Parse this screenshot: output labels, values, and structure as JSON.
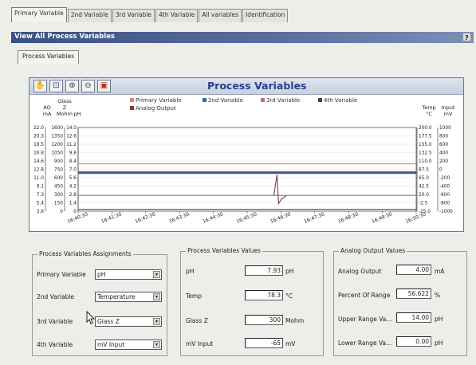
{
  "tabs": [
    "Primary Variable",
    "2nd Variable",
    "3rd Variable",
    "4th Variable",
    "All variables",
    "Identification"
  ],
  "window": {
    "title": "View All Process Variables",
    "help": "?"
  },
  "subtab": "Process Variables",
  "chart_data": {
    "type": "line",
    "title": "Process Variables",
    "legend": [
      "Primary Variable",
      "2nd Variable",
      "3rd Variable",
      "4th Variable",
      "Analog Output"
    ],
    "legend_colors": [
      "#e0857a",
      "#3b63ba",
      "#b07a82",
      "#444444",
      "#7a3a4a"
    ],
    "left_axes": [
      {
        "header": [
          "AO",
          "mA"
        ],
        "ticks": [
          "22.0",
          "20.3",
          "18.5",
          "16.8",
          "14.6",
          "12.8",
          "11.0",
          "9.1",
          "7.3",
          "5.4",
          "3.6"
        ]
      },
      {
        "header": [
          "Glass",
          "Z",
          "Mohm"
        ],
        "ticks": [
          "1600",
          "1350",
          "1200",
          "1050",
          "900",
          "750",
          "600",
          "450",
          "300",
          "150",
          "0"
        ]
      },
      {
        "header": [
          "pH"
        ],
        "ticks": [
          "14.0",
          "12.6",
          "11.2",
          "9.8",
          "8.4",
          "7.0",
          "5.6",
          "4.2",
          "2.8",
          "1.4",
          "0"
        ]
      }
    ],
    "right_axes": [
      {
        "header": [
          "Temp",
          "°C"
        ],
        "ticks": [
          "200.0",
          "177.5",
          "155.0",
          "132.5",
          "110.0",
          "87.5",
          "65.0",
          "42.5",
          "20.0",
          "-2.5",
          "-25.0"
        ]
      },
      {
        "header": [
          "Input",
          "mV"
        ],
        "ticks": [
          "1000",
          "800",
          "600",
          "400",
          "200",
          "0",
          "-200",
          "-400",
          "-600",
          "-800",
          "-1000"
        ]
      }
    ],
    "x_ticks": [
      "16:40:30",
      "16:41:30",
      "16:42:30",
      "16:43:30",
      "16:44:30",
      "16:45:30",
      "16:46:30",
      "16:47:30",
      "16:48:30",
      "16:49:30",
      "16:50:30"
    ],
    "series": [
      {
        "name": "Primary Variable",
        "color": "#e0857a",
        "values": [
          7.93,
          7.93,
          7.93,
          7.93,
          7.93,
          7.93,
          7.93,
          7.93,
          7.93,
          7.93,
          7.93
        ]
      },
      {
        "name": "2nd Variable",
        "color": "#3b63ba",
        "values": [
          78.3,
          78.3,
          78.3,
          78.3,
          78.3,
          78.3,
          78.3,
          78.3,
          78.3,
          78.3,
          78.3
        ]
      },
      {
        "name": "3rd Variable",
        "color": "#b07a82",
        "values": [
          300,
          300,
          300,
          300,
          300,
          300,
          300,
          300,
          300,
          300,
          300
        ]
      },
      {
        "name": "4th Variable",
        "color": "#444444",
        "values": [
          -65,
          -65,
          -65,
          -65,
          -65,
          -65,
          -65,
          -65,
          -65,
          -65,
          -65
        ]
      },
      {
        "name": "Analog Output",
        "color": "#7a3a4a",
        "values": [
          4.0,
          4.0,
          4.0,
          4.0,
          4.0,
          4.0,
          4.0,
          4.0,
          4.0,
          4.0,
          4.0
        ]
      }
    ]
  },
  "assignments": {
    "title": "Process Variables Assignments",
    "rows": [
      {
        "label": "Primary Variable",
        "value": "pH"
      },
      {
        "label": "2nd Variable",
        "value": "Temperature"
      },
      {
        "label": "3rd Variable",
        "value": "Glass Z"
      },
      {
        "label": "4th Variable",
        "value": "mV Input"
      }
    ]
  },
  "pv_values": {
    "title": "Process Variables Values",
    "rows": [
      {
        "label": "pH",
        "value": "7.93",
        "unit": "pH"
      },
      {
        "label": "Temp",
        "value": "78.3",
        "unit": "°C"
      },
      {
        "label": "Glass Z",
        "value": "300",
        "unit": "Mohm"
      },
      {
        "label": "mV Input",
        "value": "-65",
        "unit": "mV"
      }
    ]
  },
  "analog": {
    "title": "Analog Output Values",
    "rows": [
      {
        "label": "Analog Output",
        "value": "4.00",
        "unit": "mA"
      },
      {
        "label": "Percent Of Range",
        "value": "56.622",
        "unit": "%"
      },
      {
        "label": "Upper Range Va...",
        "value": "14.00",
        "unit": "pH"
      },
      {
        "label": "Lower Range Va...",
        "value": "0.00",
        "unit": "pH"
      }
    ]
  },
  "toolbar_icons": [
    "hand-icon",
    "zoom-box-icon",
    "zoom-in-icon",
    "zoom-out-icon",
    "print-icon"
  ]
}
